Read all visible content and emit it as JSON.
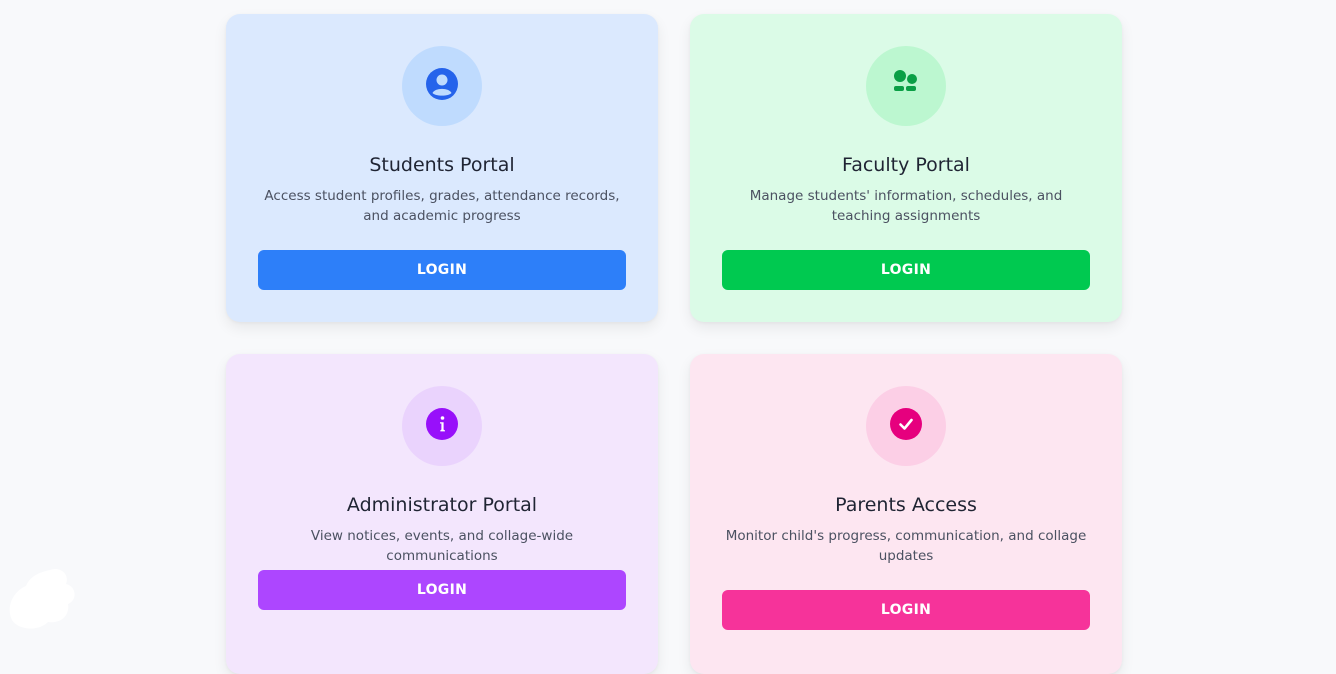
{
  "cards": [
    {
      "title": "Students Portal",
      "description": "Access student profiles, grades, attendance records, and academic progress",
      "button_label": "LOGIN",
      "icon": "user-circle-icon",
      "accent": "#2d7ff9"
    },
    {
      "title": "Faculty Portal",
      "description": "Manage students' information, schedules, and teaching assignments",
      "button_label": "LOGIN",
      "icon": "users-group-icon",
      "accent": "#00c950"
    },
    {
      "title": "Administrator Portal",
      "description": "View notices, events, and collage-wide communications",
      "button_label": "LOGIN",
      "icon": "info-circle-icon",
      "accent": "#ad46ff"
    },
    {
      "title": "Parents Access",
      "description": "Monitor child's progress, communication, and collage updates",
      "button_label": "LOGIN",
      "icon": "check-circle-icon",
      "accent": "#f6339a"
    }
  ]
}
